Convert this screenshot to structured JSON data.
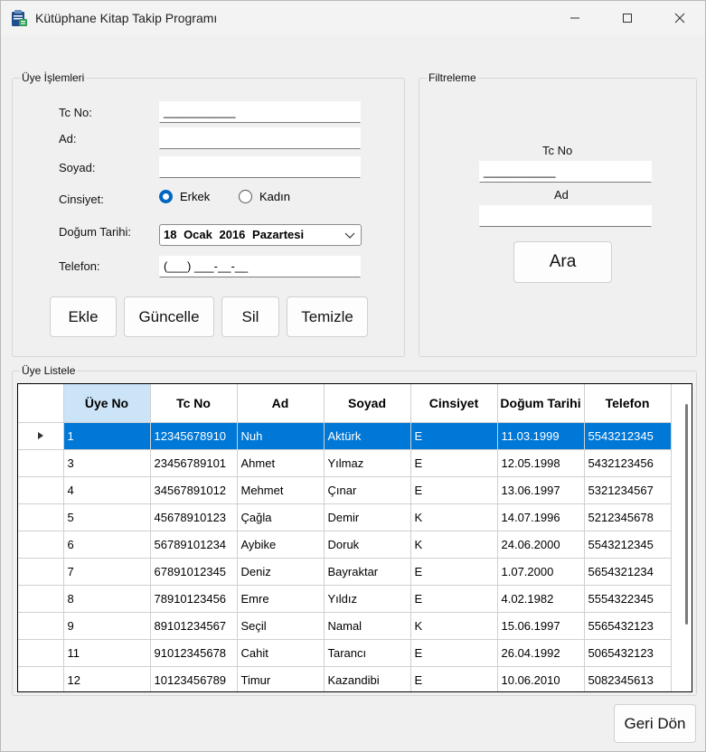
{
  "window": {
    "title": "Kütüphane Kitap Takip Programı",
    "icons": {
      "app": "clipboard-book-icon",
      "minimize": "minimize-icon",
      "maximize": "maximize-icon",
      "close": "close-icon"
    }
  },
  "uye_islemleri": {
    "legend": "Üye İşlemleri",
    "tc_label": "Tc No:",
    "tc_value": "___________",
    "ad_label": "Ad:",
    "ad_value": "",
    "soyad_label": "Soyad:",
    "soyad_value": "",
    "cinsiyet_label": "Cinsiyet:",
    "erkek_label": "Erkek",
    "kadin_label": "Kadın",
    "selected_gender": "Erkek",
    "dogum_label": "Doğum Tarihi:",
    "dogum_value": "18  Ocak  2016 Pazartesi",
    "telefon_label": "Telefon:",
    "telefon_value": "(___) ___-__-__",
    "buttons": {
      "ekle": "Ekle",
      "guncelle": "Güncelle",
      "sil": "Sil",
      "temizle": "Temizle"
    }
  },
  "filtreleme": {
    "legend": "Filtreleme",
    "tc_label": "Tc No",
    "tc_value": "___________",
    "ad_label": "Ad",
    "ad_value": "",
    "ara_label": "Ara"
  },
  "uye_listele": {
    "legend": "Üye Listele",
    "columns": [
      "Üye No",
      "Tc No",
      "Ad",
      "Soyad",
      "Cinsiyet",
      "Doğum Tarihi",
      "Telefon"
    ],
    "rows": [
      [
        "1",
        "12345678910",
        "Nuh",
        "Aktürk",
        "E",
        "11.03.1999",
        "5543212345"
      ],
      [
        "3",
        "23456789101",
        "Ahmet",
        "Yılmaz",
        "E",
        "12.05.1998",
        "5432123456"
      ],
      [
        "4",
        "34567891012",
        "Mehmet",
        "Çınar",
        "E",
        "13.06.1997",
        "5321234567"
      ],
      [
        "5",
        "45678910123",
        "Çağla",
        "Demir",
        "K",
        "14.07.1996",
        "5212345678"
      ],
      [
        "6",
        "56789101234",
        "Aybike",
        "Doruk",
        "K",
        "24.06.2000",
        "5543212345"
      ],
      [
        "7",
        "67891012345",
        "Deniz",
        "Bayraktar",
        "E",
        "1.07.2000",
        "5654321234"
      ],
      [
        "8",
        "78910123456",
        "Emre",
        "Yıldız",
        "E",
        "4.02.1982",
        "5554322345"
      ],
      [
        "9",
        "89101234567",
        "Seçil",
        "Namal",
        "K",
        "15.06.1997",
        "5565432123"
      ],
      [
        "11",
        "91012345678",
        "Cahit",
        "Tarancı",
        "E",
        "26.04.1992",
        "5065432123"
      ],
      [
        "12",
        "10123456789",
        "Timur",
        "Kazandibi",
        "E",
        "10.06.2010",
        "5082345613"
      ]
    ],
    "selected_row": 0,
    "selection_color": "#0078d7"
  },
  "geri_don_label": "Geri Dön"
}
